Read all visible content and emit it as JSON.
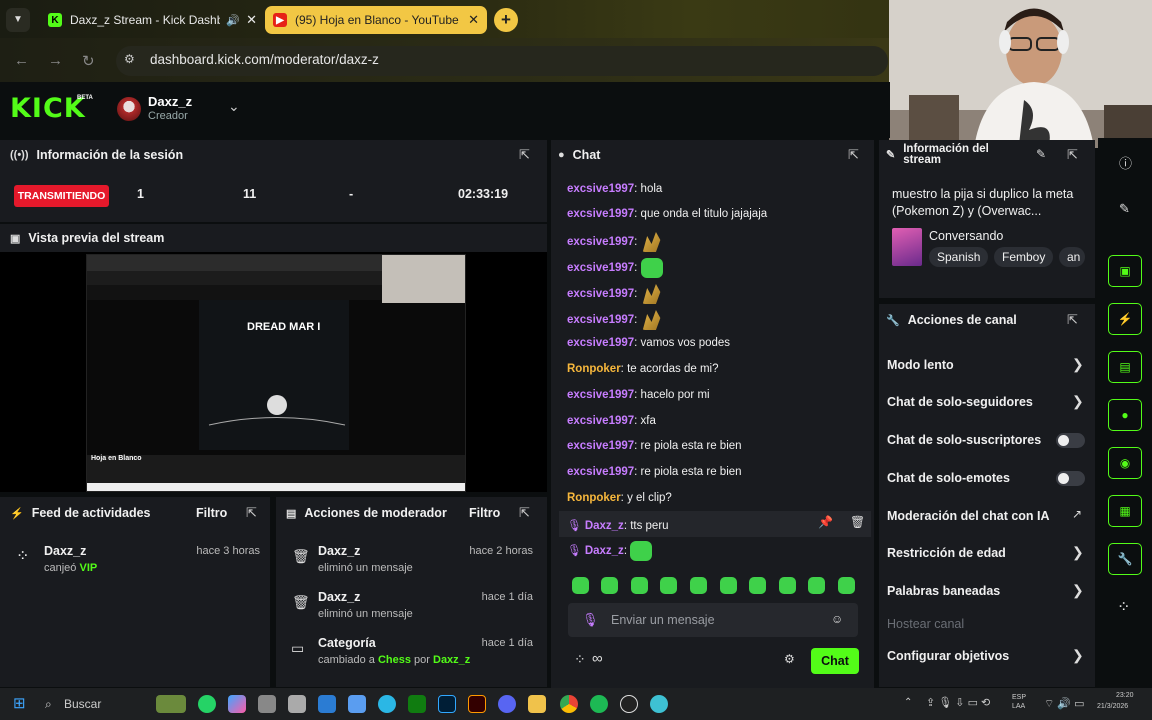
{
  "browser": {
    "tabs": [
      {
        "title": "Daxz_z Stream - Kick Dashb",
        "active": false
      },
      {
        "title": "(95) Hoja en Blanco - YouTube",
        "active": true
      }
    ],
    "url": "dashboard.kick.com/moderator/daxz-z"
  },
  "header": {
    "logo": "KICK",
    "beta": "BETA",
    "username": "Daxz_z",
    "role": "Creador"
  },
  "session": {
    "title": "Información de la sesión",
    "status": "TRANSMITIENDO",
    "stats": [
      "1",
      "11",
      "-",
      "02:33:19"
    ]
  },
  "preview": {
    "title": "Vista previa del stream",
    "inner_video_title": "DREAD MAR I",
    "inner_channel": "Hoja en Blanco"
  },
  "activity": {
    "title": "Feed de actividades",
    "filter": "Filtro",
    "items": [
      {
        "name": "Daxz_z",
        "action": "canjeó",
        "highlight": "VIP",
        "time": "hace 3 horas"
      }
    ]
  },
  "modactions": {
    "title": "Acciones de moderador",
    "filter": "Filtro",
    "items": [
      {
        "name": "Daxz_z",
        "sub": "eliminó un mensaje",
        "time": "hace 2 horas"
      },
      {
        "name": "Daxz_z",
        "sub": "eliminó un mensaje",
        "time": "hace 1 día"
      },
      {
        "name": "Categoría",
        "sub_pre": "cambiado a",
        "sub_a": "Chess",
        "sub_mid": "por",
        "sub_b": "Daxz_z",
        "time": "hace 1 día"
      }
    ]
  },
  "chat": {
    "title": "Chat",
    "messages": [
      {
        "user": "excsive1997",
        "text": "hola"
      },
      {
        "user": "excsive1997",
        "text": "que onda el titulo jajajaja"
      },
      {
        "user": "excsive1997",
        "text": ""
      },
      {
        "user": "excsive1997",
        "text": ""
      },
      {
        "user": "excsive1997",
        "text": ""
      },
      {
        "user": "excsive1997",
        "text": ""
      },
      {
        "user": "excsive1997",
        "text": "vamos vos podes"
      },
      {
        "user": "Ronpoker",
        "text": "te acordas de mi?"
      },
      {
        "user": "excsive1997",
        "text": "hacelo por mi"
      },
      {
        "user": "excsive1997",
        "text": "xfa"
      },
      {
        "user": "excsive1997",
        "text": "re piola esta re bien"
      },
      {
        "user": "excsive1997",
        "text": "re piola esta re bien"
      },
      {
        "user": "Ronpoker",
        "text": "y el clip?"
      },
      {
        "user": "Daxz_z",
        "text": "tts peru"
      },
      {
        "user": "Daxz_z",
        "text": ""
      }
    ],
    "input_placeholder": "Enviar un mensaje",
    "send": "Chat"
  },
  "streaminfo": {
    "title": "Información del stream",
    "stream_title": "muestro la pija si duplico la meta (Pokemon Z) y (Overwac...",
    "category": "Conversando",
    "tags": [
      "Spanish",
      "Femboy",
      "an"
    ]
  },
  "channelactions": {
    "title": "Acciones de canal",
    "items": [
      {
        "label": "Modo lento",
        "type": "chevron"
      },
      {
        "label": "Chat de solo-seguidores",
        "type": "chevron"
      },
      {
        "label": "Chat de solo-suscriptores",
        "type": "toggle"
      },
      {
        "label": "Chat de solo-emotes",
        "type": "toggle"
      },
      {
        "label": "Moderación del chat con IA",
        "type": "external"
      },
      {
        "label": "Restricción de edad",
        "type": "chevron"
      },
      {
        "label": "Palabras baneadas",
        "type": "chevron"
      },
      {
        "label": "Hostear canal",
        "type": "disabled"
      },
      {
        "label": "Configurar objetivos",
        "type": "chevron"
      }
    ]
  },
  "taskbar": {
    "search": "Buscar",
    "lang": "ESP\nLAA",
    "time": "23:20",
    "date": "21/3/2026"
  }
}
